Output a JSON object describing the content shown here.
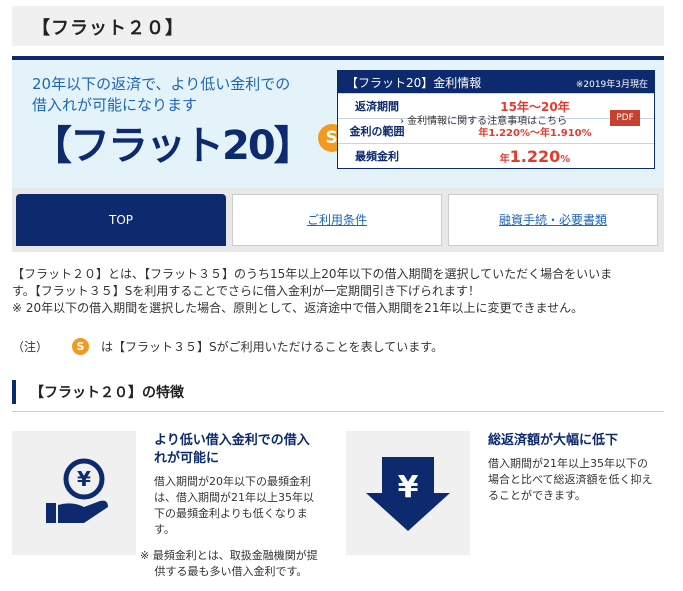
{
  "page_title": "【フラット２０】",
  "hero": {
    "tagline_1": "20年以下の返済で、より低い金利での",
    "tagline_2": "借入れが可能になります",
    "brand": "【フラット20】",
    "badge": "S"
  },
  "rate_table": {
    "title": "【フラット20】金利情報",
    "date": "※2019年3月現在",
    "rows": [
      {
        "label": "返済期間",
        "value": "15年～20年"
      },
      {
        "label": "金利の範囲",
        "value": "年1.220%～年1.910%"
      },
      {
        "label": "最頻金利",
        "prefix": "年",
        "value": "1.220",
        "suffix": "%"
      }
    ],
    "note_link": "› 金利情報に関する注意事項はこちら",
    "pdf": "PDF"
  },
  "tabs": [
    {
      "label": "TOP"
    },
    {
      "label": "ご利用条件"
    },
    {
      "label": "融資手続・必要書類"
    }
  ],
  "intro": {
    "line1": "【フラット２０】とは、【フラット３５】のうち15年以上20年以下の借入期間を選択していただく場合をいいま",
    "line2": "す。【フラット３５】Sを利用することでさらに借入金利が一定期間引き下げられます！",
    "line3": "※ 20年以下の借入期間を選択した場合、原則として、返済途中で借入期間を21年以上に変更できません。"
  },
  "note_s": {
    "prefix": "（注）",
    "badge": "S",
    "text": "は【フラット３５】Sがご利用いただけることを表しています。"
  },
  "features": {
    "title": "【フラット２０】の特徴",
    "items": [
      {
        "title_1": "より低い借入金利での借入",
        "title_2": "れが可能に",
        "body": [
          "借入期間が20年以下の最頻金利",
          "は、借入期間が21年以上35年以",
          "下の最頻金利よりも低くなりま",
          "す。"
        ],
        "note": [
          "※ 最頻金利とは、取扱金融機関が提",
          "　 供する最も多い借入金利です。"
        ],
        "icon": "yen-hand-icon"
      },
      {
        "title_1": "総返済額が大幅に低下",
        "body": [
          "借入期間が21年以上35年以下の",
          "場合と比べて総返済額を低く抑え",
          "ることができます。"
        ],
        "icon": "yen-down-arrow-icon"
      }
    ]
  },
  "colors": {
    "navy": "#0d2a6e",
    "accent_blue": "#1d66b5",
    "rate_red": "#e33b2e",
    "badge_orange": "#f39a1e",
    "hero_bg": "#e4f3fa"
  }
}
